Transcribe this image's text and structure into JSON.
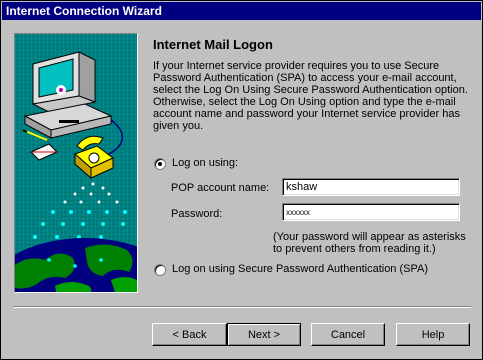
{
  "window": {
    "title": "Internet Connection Wizard"
  },
  "page": {
    "heading": "Internet Mail Logon",
    "description": "If your Internet service provider requires you to use Secure Password Authentication (SPA) to access your e-mail account, select the Log On Using Secure Password Authentication option. Otherwise, select the Log On Using option and type the e-mail account name and password your Internet service provider has given you."
  },
  "options": {
    "logon_using": {
      "label": "Log on using:",
      "selected": true
    },
    "spa": {
      "label": "Log on using Secure Password Authentication (SPA)",
      "selected": false
    }
  },
  "fields": {
    "pop_account": {
      "label": "POP account name:",
      "value": "kshaw"
    },
    "password": {
      "label": "Password:",
      "value": "xxxxxx"
    }
  },
  "note": "(Your password will appear as asterisks to prevent others from reading it.)",
  "buttons": {
    "back": "< Back",
    "next": "Next >",
    "cancel": "Cancel",
    "help": "Help"
  },
  "icons": [
    "computer-icon",
    "telephone-icon",
    "envelope-icon",
    "globe-icon"
  ]
}
